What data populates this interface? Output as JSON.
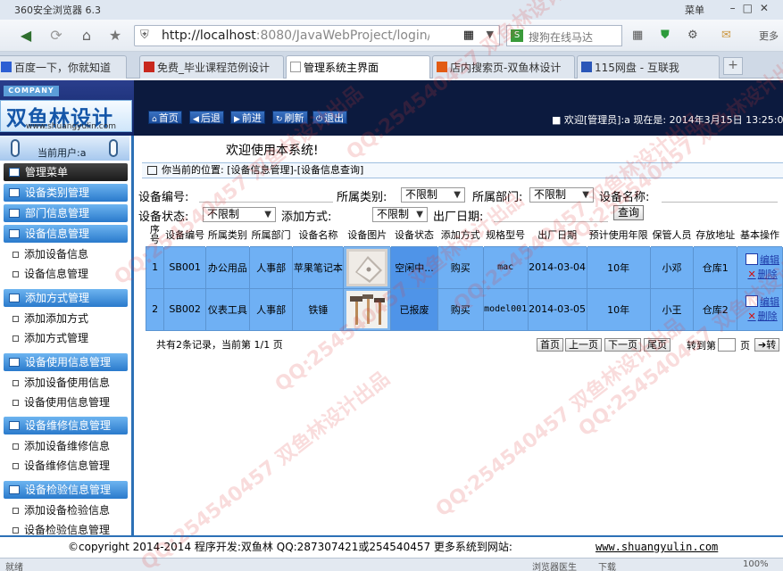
{
  "browser": {
    "title": "360安全浏览器 6.3",
    "menu_label": "菜单",
    "url_host": "http://localhost",
    "url_rest": ":8080/JavaWebProject/login/lo",
    "search_placeholder": "搜狗在线马达",
    "more_label": "更多",
    "tabs": [
      {
        "label": "百度一下，你就知道",
        "icon_color": "#2d5fd3"
      },
      {
        "label": "免费_毕业课程范例设计",
        "icon_color": "#c8281e"
      },
      {
        "label": "管理系统主界面",
        "icon_color": "#ffffff"
      },
      {
        "label": "店内搜索页-双鱼林设计",
        "icon_color": "#e25b14"
      },
      {
        "label": "115网盘 - 互联我",
        "icon_color": "#2a56b8"
      }
    ],
    "status_left": "就绪",
    "status_items": [
      "浏览器医生",
      "下载",
      "100%"
    ]
  },
  "header": {
    "company_badge": "COMPANY",
    "logo_text": "双鱼林设计",
    "logo_domain": "www.shuangyulin.com",
    "nav": [
      {
        "label": "首页",
        "icon": "home-icon"
      },
      {
        "label": "后退",
        "icon": "back-icon"
      },
      {
        "label": "前进",
        "icon": "forward-icon"
      },
      {
        "label": "刷新",
        "icon": "refresh-icon"
      },
      {
        "label": "退出",
        "icon": "power-icon"
      }
    ],
    "welcome": "■ 欢迎[管理员]:a 现在是: 2014年3月15日 13:25:01"
  },
  "sidebar": {
    "current_user": "当前用户:a",
    "menu_title": "管理菜单",
    "groups": [
      {
        "title": "设备类别管理",
        "items": []
      },
      {
        "title": "部门信息管理",
        "items": []
      },
      {
        "title": "设备信息管理",
        "items": [
          "添加设备信息",
          "设备信息管理"
        ]
      },
      {
        "title": "添加方式管理",
        "items": [
          "添加添加方式",
          "添加方式管理"
        ]
      },
      {
        "title": "设备使用信息管理",
        "items": [
          "添加设备使用信息",
          "设备使用信息管理"
        ]
      },
      {
        "title": "设备维修信息管理",
        "items": [
          "添加设备维修信息",
          "设备维修信息管理"
        ]
      },
      {
        "title": "设备检验信息管理",
        "items": [
          "添加设备检验信息",
          "设备检验信息管理"
        ]
      }
    ]
  },
  "main": {
    "welcome_msg": "欢迎使用本系统!",
    "location": "你当前的位置: [设备信息管理]-[设备信息查询]",
    "filters": {
      "device_no_label": "设备编号:",
      "category_label": "所属类别:",
      "category_value": "不限制",
      "dept_label": "所属部门:",
      "dept_value": "不限制",
      "name_label": "设备名称:",
      "state_label": "设备状态:",
      "state_value": "不限制",
      "method_label": "添加方式:",
      "method_value": "不限制",
      "date_label": "出厂日期:",
      "query_label": "查询"
    },
    "columns": [
      "序号",
      "设备编号",
      "所属类别",
      "所属部门",
      "设备名称",
      "设备图片",
      "设备状态",
      "添加方式",
      "规格型号",
      "出厂日期",
      "预计使用年限",
      "保管人员",
      "存放地址",
      "基本操作"
    ],
    "rows": [
      {
        "no": "1",
        "code": "SB001",
        "category": "办公用品",
        "dept": "人事部",
        "name": "苹果笔记本",
        "image": "laptop",
        "state": "空闲中...",
        "method": "购买",
        "model": "mac",
        "date": "2014-03-04",
        "years": "10年",
        "keeper": "小邓",
        "location": "仓库1",
        "edit": "编辑",
        "delete": "删除"
      },
      {
        "no": "2",
        "code": "SB002",
        "category": "仪表工具",
        "dept": "人事部",
        "name": "铁锤",
        "image": "hammers",
        "state": "已报废",
        "method": "购买",
        "model": "model001",
        "date": "2014-03-05",
        "years": "10年",
        "keeper": "小王",
        "location": "仓库2",
        "edit": "编辑",
        "delete": "删除"
      }
    ],
    "pager": {
      "info": "共有2条记录，当前第 1/1 页",
      "first": "首页",
      "prev": "上一页",
      "next": "下一页",
      "last": "尾页",
      "goto": "转到第",
      "page_suffix": "页",
      "go": "转"
    }
  },
  "footer": {
    "copyright": "©copyright 2014-2014 程序开发:双鱼林  QQ:287307421或254540457  更多系统到网站:",
    "site": "www.shuangyulin.com"
  },
  "watermark": "QQ:254540457 双鱼林设计出品"
}
